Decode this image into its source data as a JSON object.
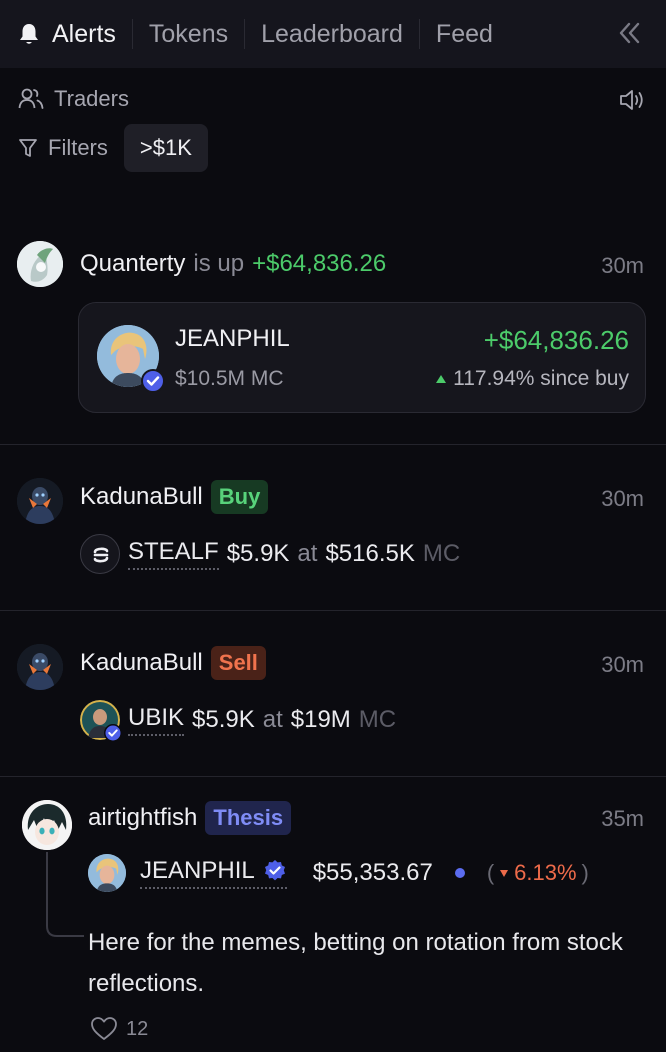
{
  "nav": {
    "tabs": [
      "Alerts",
      "Tokens",
      "Leaderboard",
      "Feed"
    ],
    "active_tab": "Alerts"
  },
  "subheader": {
    "traders_label": "Traders",
    "filters_label": "Filters",
    "filter_chip": ">$1K"
  },
  "alerts": [
    {
      "user": "Quanterty",
      "action": "is up",
      "amount": "+$64,836.26",
      "time": "30m",
      "card": {
        "token": "JEANPHIL",
        "mc": "$10.5M MC",
        "pnl": "+$64,836.26",
        "change": "117.94% since buy"
      }
    },
    {
      "user": "KadunaBull",
      "badge": "Buy",
      "time": "30m",
      "token": "STEALF",
      "size": "$5.9K",
      "at": "at",
      "mc_value": "$516.5K",
      "mc_label": "MC"
    },
    {
      "user": "KadunaBull",
      "badge": "Sell",
      "time": "30m",
      "token": "UBIK",
      "size": "$5.9K",
      "at": "at",
      "mc_value": "$19M",
      "mc_label": "MC"
    },
    {
      "user": "airtightfish",
      "badge": "Thesis",
      "time": "35m",
      "token": "JEANPHIL",
      "price": "$55,353.67",
      "change": "6.13%",
      "paren_open": "(",
      "paren_close": ")",
      "text": "Here for the memes, betting on rotation from stock reflections.",
      "likes": "12"
    }
  ],
  "colors": {
    "background": "#0b0b10",
    "green": "#4ccb6a",
    "red": "#ee6b4a",
    "accent": "#5b6cf0"
  }
}
